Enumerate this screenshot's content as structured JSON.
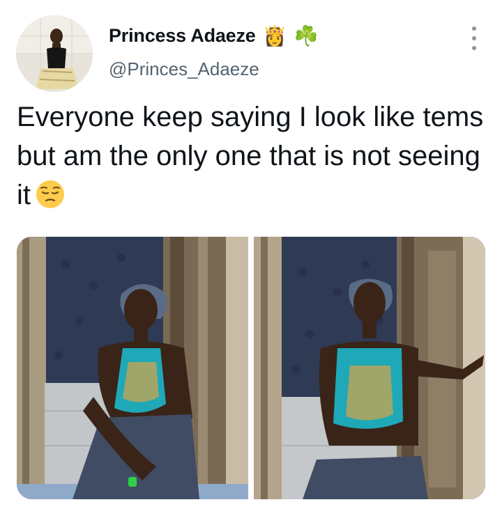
{
  "tweet": {
    "author": {
      "display_name": "Princess Adaeze",
      "badge_emojis": [
        "👸",
        "☘️"
      ],
      "handle": "@Princes_Adaeze",
      "avatar_icon": "profile-photo-avatar"
    },
    "text": "Everyone keep saying I look like tems but am the only one that is not seeing it",
    "text_emoji_icon": "pensive-face-emoji",
    "more_icon": "vertical-ellipsis-icon",
    "media": [
      {
        "icon": "photo-woman-seated-doorway",
        "alt": ""
      },
      {
        "icon": "photo-woman-leaning-door",
        "alt": ""
      }
    ]
  },
  "colors": {
    "text_primary": "#0f1419",
    "text_secondary": "#536471",
    "background": "#ffffff",
    "top_teal": "#1fa9b8",
    "emoji_yellow": "#ffcb4c"
  }
}
